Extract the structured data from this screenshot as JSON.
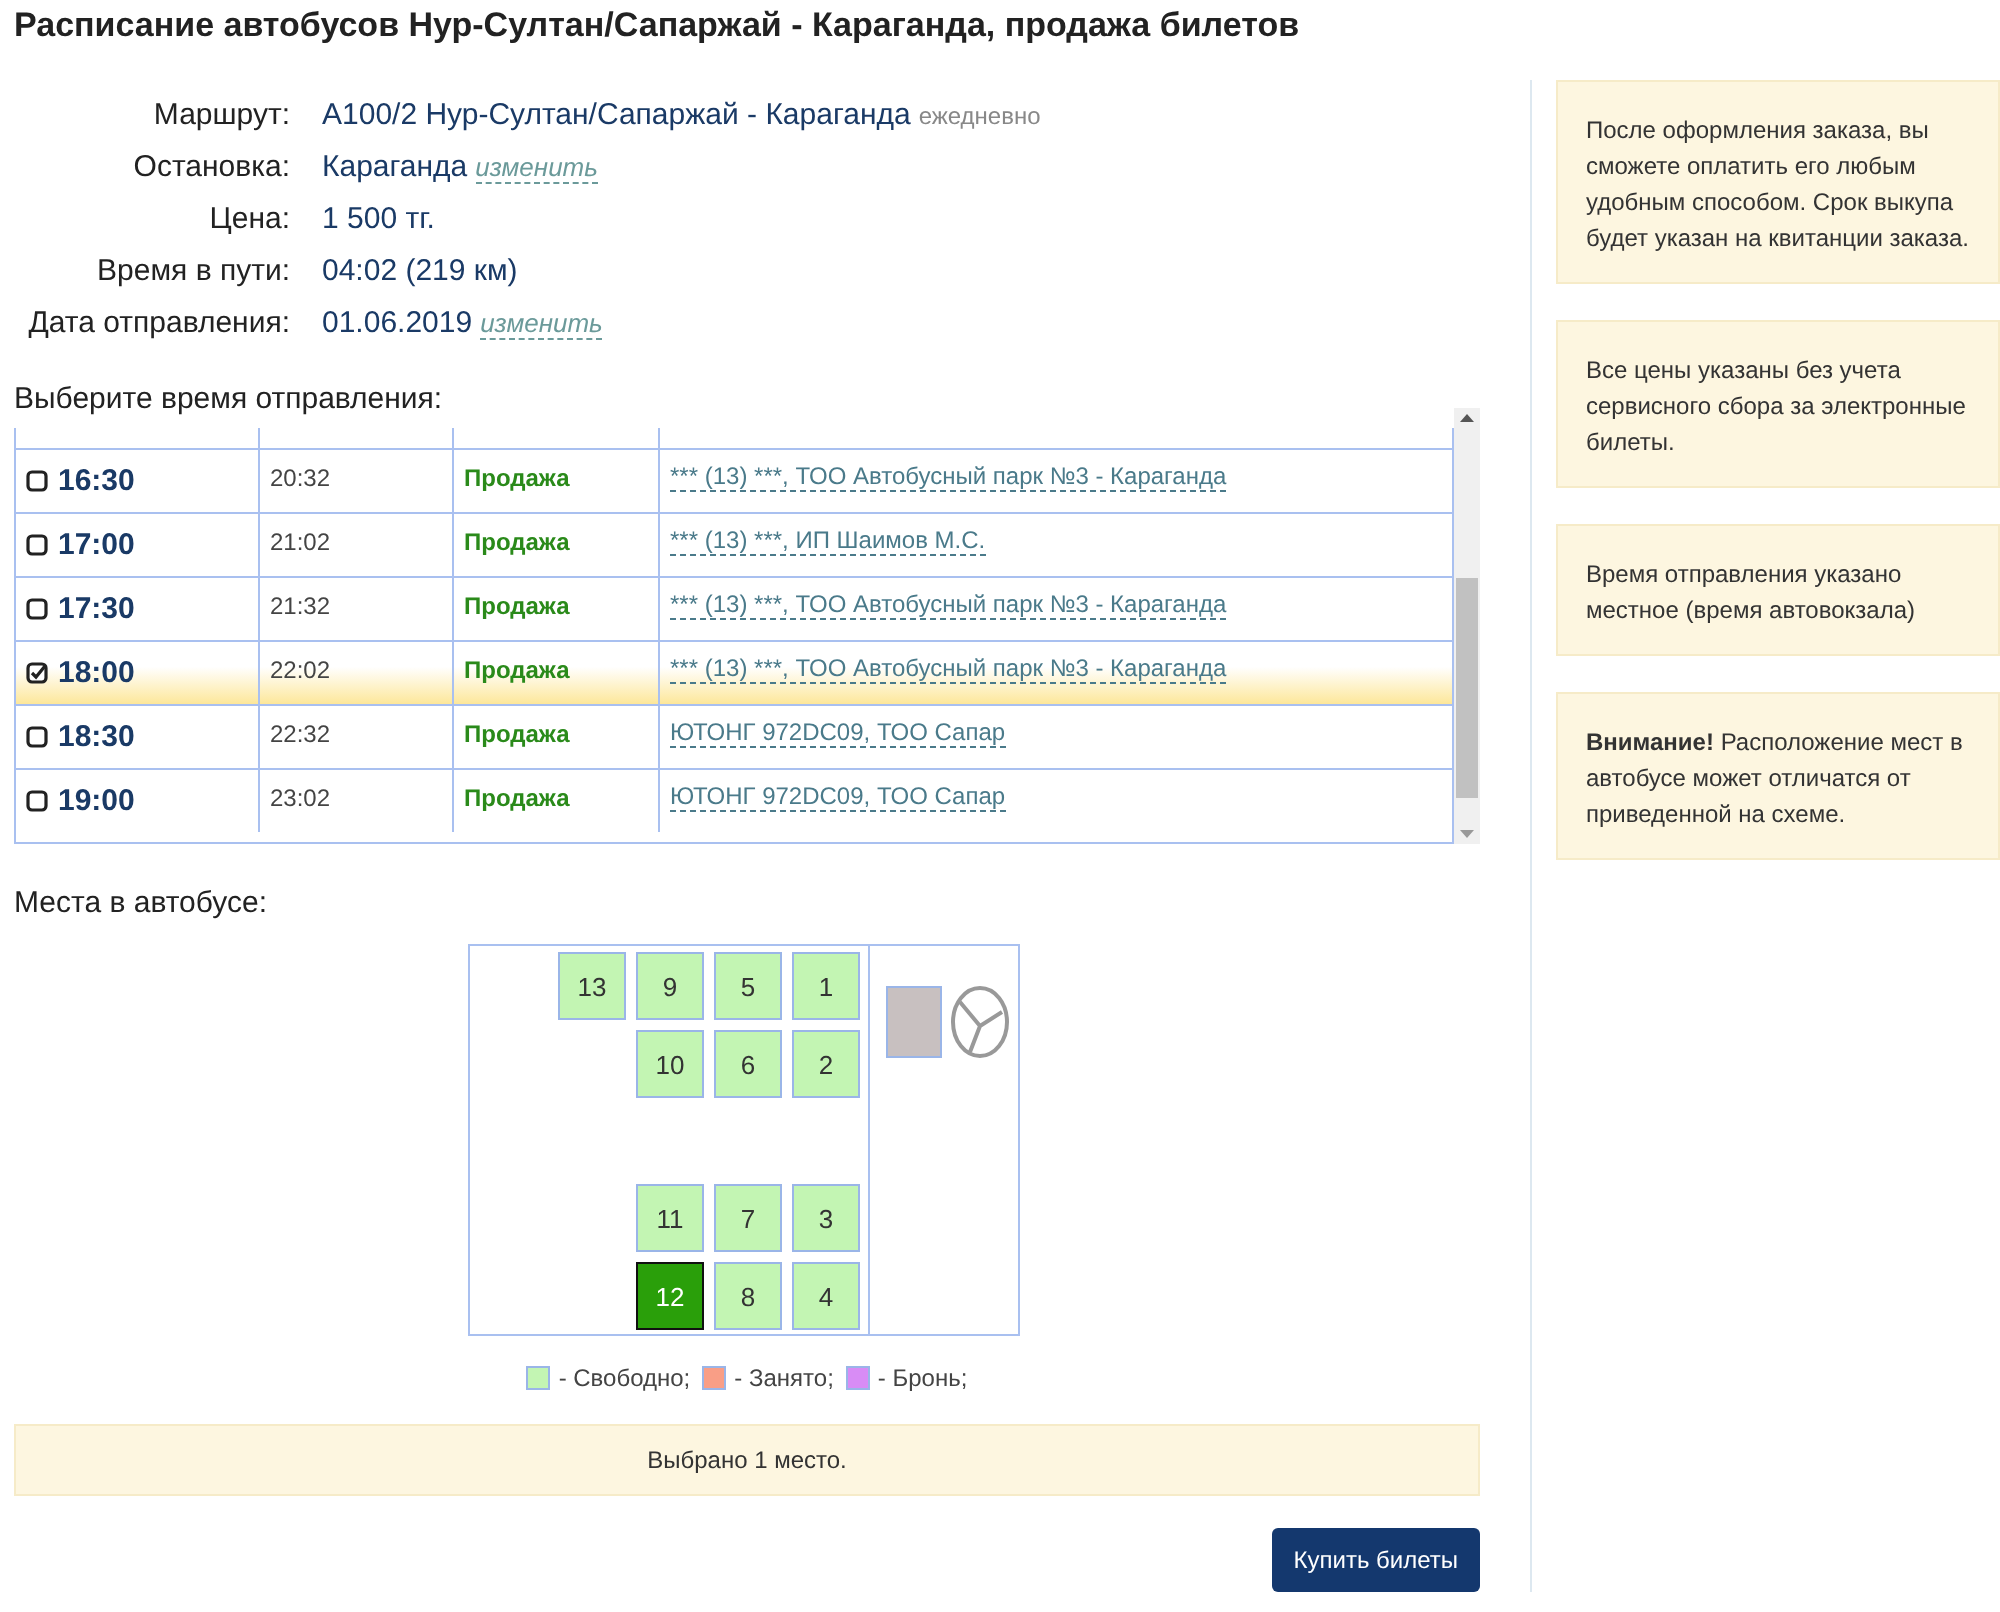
{
  "title": "Расписание автобусов Нур-Султан/Сапаржай - Караганда, продажа билетов",
  "info": [
    {
      "label": "Маршрут:",
      "value": "А100/2 Нур-Султан/Сапаржай - Караганда",
      "note": "ежедневно"
    },
    {
      "label": "Остановка:",
      "value": "Караганда",
      "link": "изменить"
    },
    {
      "label": "Цена:",
      "value": "1 500 тг."
    },
    {
      "label": "Время в пути:",
      "value": "04:02 (219 км)"
    },
    {
      "label": "Дата отправления:",
      "value": "01.06.2019",
      "link": "изменить"
    }
  ],
  "schedule_heading": "Выберите время отправления:",
  "schedule": [
    {
      "departure": "16:30",
      "arrival": "20:32",
      "status": "Продажа",
      "carrier": "*** (13) ***, ТОО Автобусный парк №3 - Караганда",
      "selected": false
    },
    {
      "departure": "17:00",
      "arrival": "21:02",
      "status": "Продажа",
      "carrier": "*** (13) ***, ИП Шаимов М.С.",
      "selected": false
    },
    {
      "departure": "17:30",
      "arrival": "21:32",
      "status": "Продажа",
      "carrier": "*** (13) ***, ТОО Автобусный парк №3 - Караганда",
      "selected": false
    },
    {
      "departure": "18:00",
      "arrival": "22:02",
      "status": "Продажа",
      "carrier": "*** (13) ***, ТОО Автобусный парк №3 - Караганда",
      "selected": true
    },
    {
      "departure": "18:30",
      "arrival": "22:32",
      "status": "Продажа",
      "carrier": "ЮТОНГ 972DC09, ТОО Сапар",
      "selected": false
    },
    {
      "departure": "19:00",
      "arrival": "23:02",
      "status": "Продажа",
      "carrier": "ЮТОНГ 972DC09, ТОО Сапар",
      "selected": false
    }
  ],
  "seats_heading": "Места в автобусе:",
  "seat_rows": [
    {
      "seats": [
        {
          "number": "13",
          "selected": false
        },
        {
          "number": "9",
          "selected": false
        },
        {
          "number": "5",
          "selected": false
        },
        {
          "number": "1",
          "selected": false
        }
      ]
    },
    {
      "seats": [
        {
          "number": "10",
          "selected": false
        },
        {
          "number": "6",
          "selected": false
        },
        {
          "number": "2",
          "selected": false
        }
      ]
    },
    {
      "seats": [
        {
          "number": "11",
          "selected": false
        },
        {
          "number": "7",
          "selected": false
        },
        {
          "number": "3",
          "selected": false
        }
      ]
    },
    {
      "seats": [
        {
          "number": "12",
          "selected": true
        },
        {
          "number": "8",
          "selected": false
        },
        {
          "number": "4",
          "selected": false
        }
      ]
    }
  ],
  "legend": [
    {
      "label": "- Свободно;",
      "color": "#c3f5b3"
    },
    {
      "label": "- Занято;",
      "color": "#f99e86"
    },
    {
      "label": "- Бронь;",
      "color": "#d88cf5"
    }
  ],
  "selection_summary": "Выбрано 1 место.",
  "buy_button": "Купить билеты",
  "notes": [
    "После оформления заказа, вы сможете оплатить его любым удобным способом. Срок выкупа будет указан на квитанции заказа.",
    "Все цены указаны без учета сервисного сбора за электронные билеты.",
    "Время отправления указано местное (время автовокзала)",
    "**Внимание!** Расположение мест в автобусе может отличатся от приведенной на схеме."
  ]
}
